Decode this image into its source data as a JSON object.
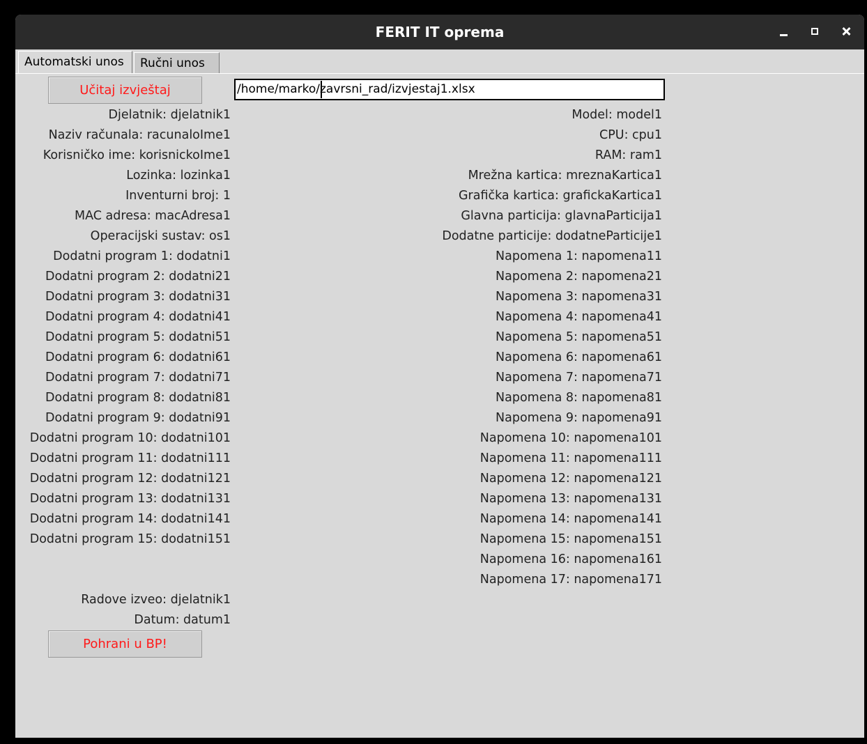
{
  "window": {
    "title": "FERIT IT oprema"
  },
  "tabs": [
    {
      "label": "Automatski unos",
      "active": true
    },
    {
      "label": "Ručni unos",
      "active": false
    }
  ],
  "load_button": {
    "label": "Učitaj izvještaj"
  },
  "path_input": {
    "value": "/home/marko/zavrsni_rad/izvjestaj1.xlsx"
  },
  "left_fields": [
    "Djelatnik: djelatnik1",
    "Naziv računala: racunaloIme1",
    "Korisničko ime: korisnickoIme1",
    "Lozinka: lozinka1",
    "Inventurni broj: 1",
    "MAC adresa: macAdresa1",
    "Operacijski sustav: os1",
    "Dodatni program 1: dodatni1",
    "Dodatni program 2: dodatni21",
    "Dodatni program 3: dodatni31",
    "Dodatni program 4: dodatni41",
    "Dodatni program 5: dodatni51",
    "Dodatni program 6: dodatni61",
    "Dodatni program 7: dodatni71",
    "Dodatni program 8: dodatni81",
    "Dodatni program 9: dodatni91",
    "Dodatni program 10: dodatni101",
    "Dodatni program 11: dodatni111",
    "Dodatni program 12: dodatni121",
    "Dodatni program 13: dodatni131",
    "Dodatni program 14: dodatni141",
    "Dodatni program 15: dodatni151"
  ],
  "right_fields": [
    "Model: model1",
    "CPU: cpu1",
    "RAM: ram1",
    "Mrežna kartica: mreznaKartica1",
    "Grafička kartica: grafickaKartica1",
    "Glavna particija: glavnaParticija1",
    "Dodatne particije: dodatneParticije1",
    "Napomena 1: napomena11",
    "Napomena 2: napomena21",
    "Napomena 3: napomena31",
    "Napomena 4: napomena41",
    "Napomena 5: napomena51",
    "Napomena 6: napomena61",
    "Napomena 7: napomena71",
    "Napomena 8: napomena81",
    "Napomena 9: napomena91",
    "Napomena 10: napomena101",
    "Napomena 11: napomena111",
    "Napomena 12: napomena121",
    "Napomena 13: napomena131",
    "Napomena 14: napomena141",
    "Napomena 15: napomena151",
    "Napomena 16: napomena161",
    "Napomena 17: napomena171"
  ],
  "footer_fields": [
    "Radove izveo: djelatnik1",
    "Datum: datum1"
  ],
  "save_button": {
    "label": "Pohrani u BP!"
  },
  "colors": {
    "button_text": "#ff1a1a",
    "titlebar": "#2b2b2b",
    "window_bg": "#d9d9d9"
  },
  "icons": [
    "minimize-icon",
    "maximize-icon",
    "close-icon"
  ]
}
